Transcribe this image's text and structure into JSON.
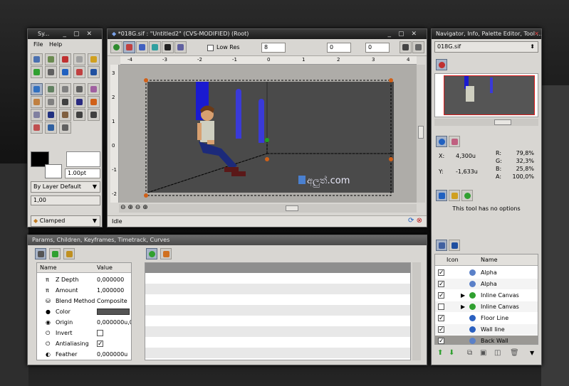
{
  "toolbox": {
    "title": "Sy...",
    "menu": [
      "File",
      "Help"
    ],
    "line_width": "1.00pt",
    "blend_method": "By Layer Default",
    "amount": "1,00",
    "interp": "Clamped"
  },
  "canvas": {
    "title": "*018G.sif : \"Untitled2\" (CVS-MODIFIED) (Root)",
    "lowres_label": "Low Res",
    "frame": "8",
    "time1": "0",
    "time2": "0",
    "status": "Idle",
    "watermark_text": "අලුත්.com",
    "h_ruler": [
      "-4",
      "-3",
      "-2",
      "-1",
      "0",
      "1",
      "2",
      "3",
      "4"
    ],
    "v_ruler": [
      "3",
      "2",
      "1",
      "0",
      "-1",
      "-2"
    ]
  },
  "navigator": {
    "title": "Navigator, Info, Palette Editor, Tool ...",
    "file": "018G.sif"
  },
  "info": {
    "x_label": "X:",
    "x_value": "4,300u",
    "y_label": "Y:",
    "y_value": "-1,633u",
    "r": "79,8%",
    "g": "32,3%",
    "b": "25,8%",
    "a": "100,0%",
    "r_label": "R:",
    "g_label": "G:",
    "b_label": "B:",
    "a_label": "A:"
  },
  "tool_options": {
    "text": "This tool has no options"
  },
  "layers": {
    "col_icon": "Icon",
    "col_name": "Name",
    "rows": [
      {
        "name": "Alpha",
        "checked": true
      },
      {
        "name": "Alpha",
        "checked": true
      },
      {
        "name": "Inline Canvas",
        "checked": true
      },
      {
        "name": "Inline Canvas",
        "checked": false
      },
      {
        "name": "Floor Line",
        "checked": true
      },
      {
        "name": "Wall line",
        "checked": true
      },
      {
        "name": "Back Wall",
        "checked": true
      }
    ]
  },
  "params": {
    "title": "Params, Children, Keyframes, Timetrack, Curves",
    "col_name": "Name",
    "col_value": "Value",
    "rows": [
      {
        "name": "Z Depth",
        "value": "0,000000"
      },
      {
        "name": "Amount",
        "value": "1,000000"
      },
      {
        "name": "Blend Method",
        "value": "Composite"
      },
      {
        "name": "Color",
        "value": ""
      },
      {
        "name": "Origin",
        "value": "0,000000u,0,0"
      },
      {
        "name": "Invert",
        "value": ""
      },
      {
        "name": "Antialiasing",
        "value": ""
      },
      {
        "name": "Feather",
        "value": "0,000000u"
      }
    ]
  },
  "colors": {
    "canvas_bg": "#4a4a4a",
    "figure_shirt": "#cfcfc0",
    "figure_pants": "#1c2a7a",
    "blue_column": "#1a1ad0",
    "selection_red": "#e02020"
  }
}
